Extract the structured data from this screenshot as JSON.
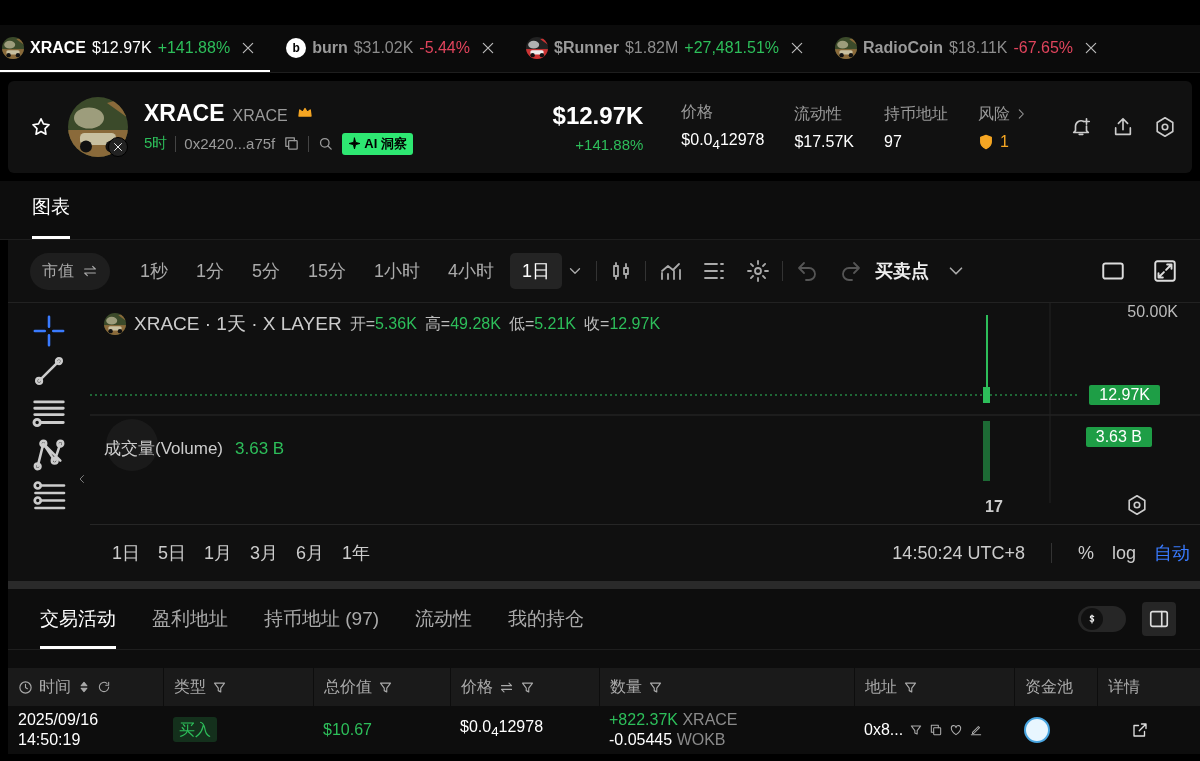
{
  "token_tabs": [
    {
      "symbol": "XRACE",
      "market_cap": "$12.97K",
      "change": "+141.88%",
      "color": "#2dbe5a",
      "selected": true,
      "kind": "picture"
    },
    {
      "symbol": "burn",
      "market_cap": "$31.02K",
      "change": "-5.44%",
      "color": "#e0445c",
      "selected": false,
      "kind": "letter",
      "letter": "b"
    },
    {
      "symbol": "$Runner",
      "market_cap": "$1.82M",
      "change": "+27,481.51%",
      "color": "#2dbe5a",
      "selected": false,
      "kind": "picture"
    },
    {
      "symbol": "RadioCoin",
      "market_cap": "$18.11K",
      "change": "-67.65%",
      "color": "#e0445c",
      "selected": false,
      "kind": "picture"
    }
  ],
  "token": {
    "name": "XRACE",
    "ticker": "XRACE",
    "age": "5时",
    "address": "0x2420...a75f",
    "ai_badge": "AI 洞察",
    "market_cap": "$12.97K",
    "change": "+141.88%",
    "stats": [
      {
        "label": "价格",
        "value": "$0.0$_{4}$12978",
        "kind": "plain"
      },
      {
        "label": "流动性",
        "value": "$17.57K",
        "kind": "plain"
      },
      {
        "label": "持币地址",
        "value": "97",
        "kind": "plain"
      },
      {
        "label": "风险",
        "value": "1",
        "kind": "risk"
      }
    ]
  },
  "section_tabs": [
    {
      "label": "图表",
      "selected": true
    }
  ],
  "chart": {
    "metric_toggle": "市值",
    "intervals": [
      {
        "label": "1秒",
        "selected": false
      },
      {
        "label": "1分",
        "selected": false
      },
      {
        "label": "5分",
        "selected": false
      },
      {
        "label": "15分",
        "selected": false
      },
      {
        "label": "1小时",
        "selected": false
      },
      {
        "label": "4小时",
        "selected": false
      },
      {
        "label": "1日",
        "selected": true
      }
    ],
    "trade_points": "买卖点",
    "legend_title": "XRACE · 1天 · X LAYER",
    "ohlc": [
      {
        "label": "开=",
        "value": "5.36K"
      },
      {
        "label": "高=",
        "value": "49.28K"
      },
      {
        "label": "低=",
        "value": "5.21K"
      },
      {
        "label": "收=",
        "value": "12.97K"
      }
    ],
    "volume_label": "成交量(Volume)",
    "volume_value": "3.63 B",
    "axis_top": "50.00K",
    "last_price_tag": "12.97K",
    "volume_tag": "3.63 B",
    "date_label": "17",
    "ranges": [
      "1日",
      "5日",
      "1月",
      "3月",
      "6月",
      "1年"
    ],
    "time": "14:50:24 UTC+8",
    "percent": "%",
    "log": "log",
    "auto": {
      "label": "自动",
      "on": true
    }
  },
  "activity_tabs": [
    {
      "label": "交易活动",
      "selected": true
    },
    {
      "label": "盈利地址",
      "selected": false
    },
    {
      "label": "持币地址 (97)",
      "selected": false
    },
    {
      "label": "流动性",
      "selected": false
    },
    {
      "label": "我的持仓",
      "selected": false
    }
  ],
  "currency_toggle": {
    "on": false
  },
  "table": {
    "columns": [
      {
        "label": "时间",
        "kind": "time"
      },
      {
        "label": "类型",
        "kind": "filter"
      },
      {
        "label": "总价值",
        "kind": "filter"
      },
      {
        "label": "价格",
        "kind": "swap"
      },
      {
        "label": "数量",
        "kind": "filter"
      },
      {
        "label": "地址",
        "kind": "filter"
      },
      {
        "label": "资金池",
        "kind": "plain"
      },
      {
        "label": "详情",
        "kind": "plain"
      }
    ],
    "rows": [
      {
        "date": "2025/09/16",
        "time": "14:50:19",
        "type": "买入",
        "color": "#2dbe5a",
        "total": "$10.67",
        "price": "$0.0$_{4}$12978",
        "amount_in": "+822.37K",
        "token_in": "XRACE",
        "amount_out": "-0.05445",
        "token_out": "WOKB",
        "address": "0x8..."
      }
    ]
  }
}
